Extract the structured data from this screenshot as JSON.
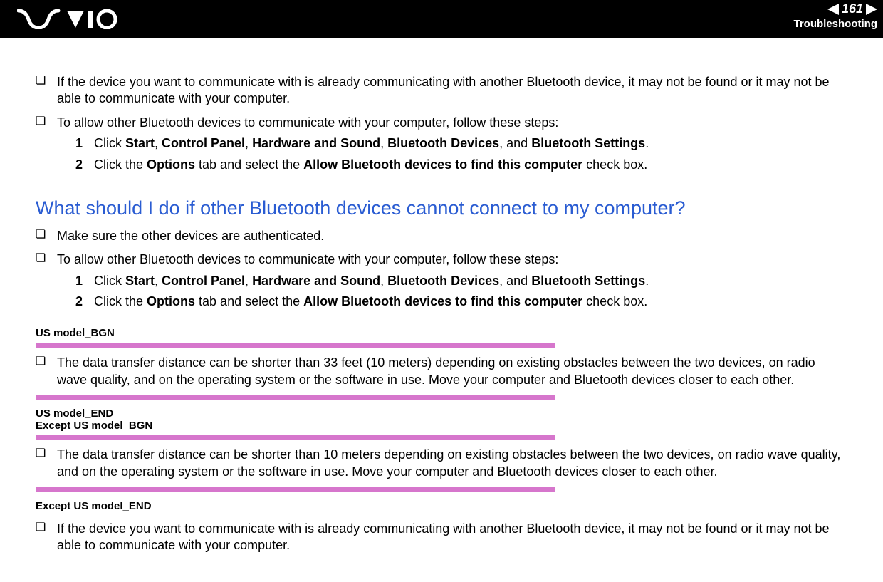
{
  "header": {
    "page_number": "161",
    "section": "Troubleshooting"
  },
  "content": {
    "bullet1": "If the device you want to communicate with is already communicating with another Bluetooth device, it may not be found or it may not be able to communicate with your computer.",
    "bullet2": "To allow other Bluetooth devices to communicate with your computer, follow these steps:",
    "step1_prefix": "Click ",
    "step1_b1": "Start",
    "step1_c1": ", ",
    "step1_b2": "Control Panel",
    "step1_c2": ", ",
    "step1_b3": "Hardware and Sound",
    "step1_c3": ", ",
    "step1_b4": "Bluetooth Devices",
    "step1_c4": ", and ",
    "step1_b5": "Bluetooth Settings",
    "step1_suffix": ".",
    "step2_prefix": "Click the ",
    "step2_b1": "Options",
    "step2_mid": " tab and select the ",
    "step2_b2": "Allow Bluetooth devices to find this computer",
    "step2_suffix": " check box.",
    "heading": "What should I do if other Bluetooth devices cannot connect to my computer?",
    "bullet3": "Make sure the other devices are authenticated.",
    "bullet4": "To allow other Bluetooth devices to communicate with your computer, follow these steps:",
    "tag_us_bgn": "US model_BGN",
    "bullet5": "The data transfer distance can be shorter than 33 feet (10 meters) depending on existing obstacles between the two devices, on radio wave quality, and on the operating system or the software in use. Move your computer and Bluetooth devices closer to each other.",
    "tag_us_end": "US model_END",
    "tag_ex_bgn": "Except US model_BGN",
    "bullet6": "The data transfer distance can be shorter than 10 meters depending on existing obstacles between the two devices, on radio wave quality, and on the operating system or the software in use. Move your computer and Bluetooth devices closer to each other.",
    "tag_ex_end": "Except US model_END",
    "bullet7": "If the device you want to communicate with is already communicating with another Bluetooth device, it may not be found or it may not be able to communicate with your computer."
  },
  "numbers": {
    "n1": "1",
    "n2": "2"
  },
  "bullet_glyph": "❏"
}
